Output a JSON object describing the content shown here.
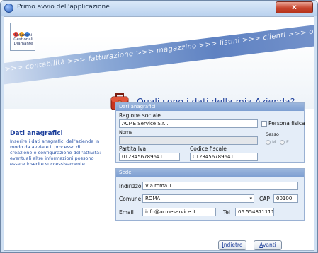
{
  "window": {
    "title": "Primo avvio dell'applicazione",
    "close_label": "x"
  },
  "logo": {
    "text": "Soluzioni Gestionali Diamante",
    "dot_colors": [
      "#e83b2f",
      "#f4a21c",
      "#3a7fd8"
    ]
  },
  "banner": {
    "ribbon_text": ">>> contabilità >>> fatturazione >>> magazzino >>> listini >>> clienti >>> ordini >>> stati"
  },
  "heading": "Quali sono i dati della mia Azienda?",
  "info": {
    "title": "Dati anagrafici",
    "description": "Inserire i dati anagrafici dell'azienda in modo da avviare il processo di creazione e configurazione dell'attività: eventuali altre informazioni possono essere inserite successivamente."
  },
  "anagrafica": {
    "header": "Dati anagrafici",
    "ragione_sociale_label": "Ragione sociale",
    "ragione_sociale_value": "ACME Service S.r.l.",
    "persona_fisica_label": "Persona fisica",
    "nome_label": "Nome",
    "nome_value": "",
    "sesso_label": "Sesso",
    "sesso_m": "M",
    "sesso_f": "F",
    "partita_iva_label": "Partita Iva",
    "partita_iva_value": "0123456789641",
    "codice_fiscale_label": "Codice fiscale",
    "codice_fiscale_value": "0123456789641"
  },
  "sede": {
    "header": "Sede",
    "indirizzo_label": "Indirizzo",
    "indirizzo_value": "Via roma 1",
    "comune_label": "Comune",
    "comune_value": "ROMA",
    "cap_label": "CAP",
    "cap_value": "00100",
    "email_label": "Email",
    "email_value": "info@acmeservice.it",
    "tel_label": "Tel",
    "tel_value": "06 554871111"
  },
  "buttons": {
    "back_first": "I",
    "back_rest": "ndietro",
    "next_first": "A",
    "next_rest": "vanti"
  }
}
